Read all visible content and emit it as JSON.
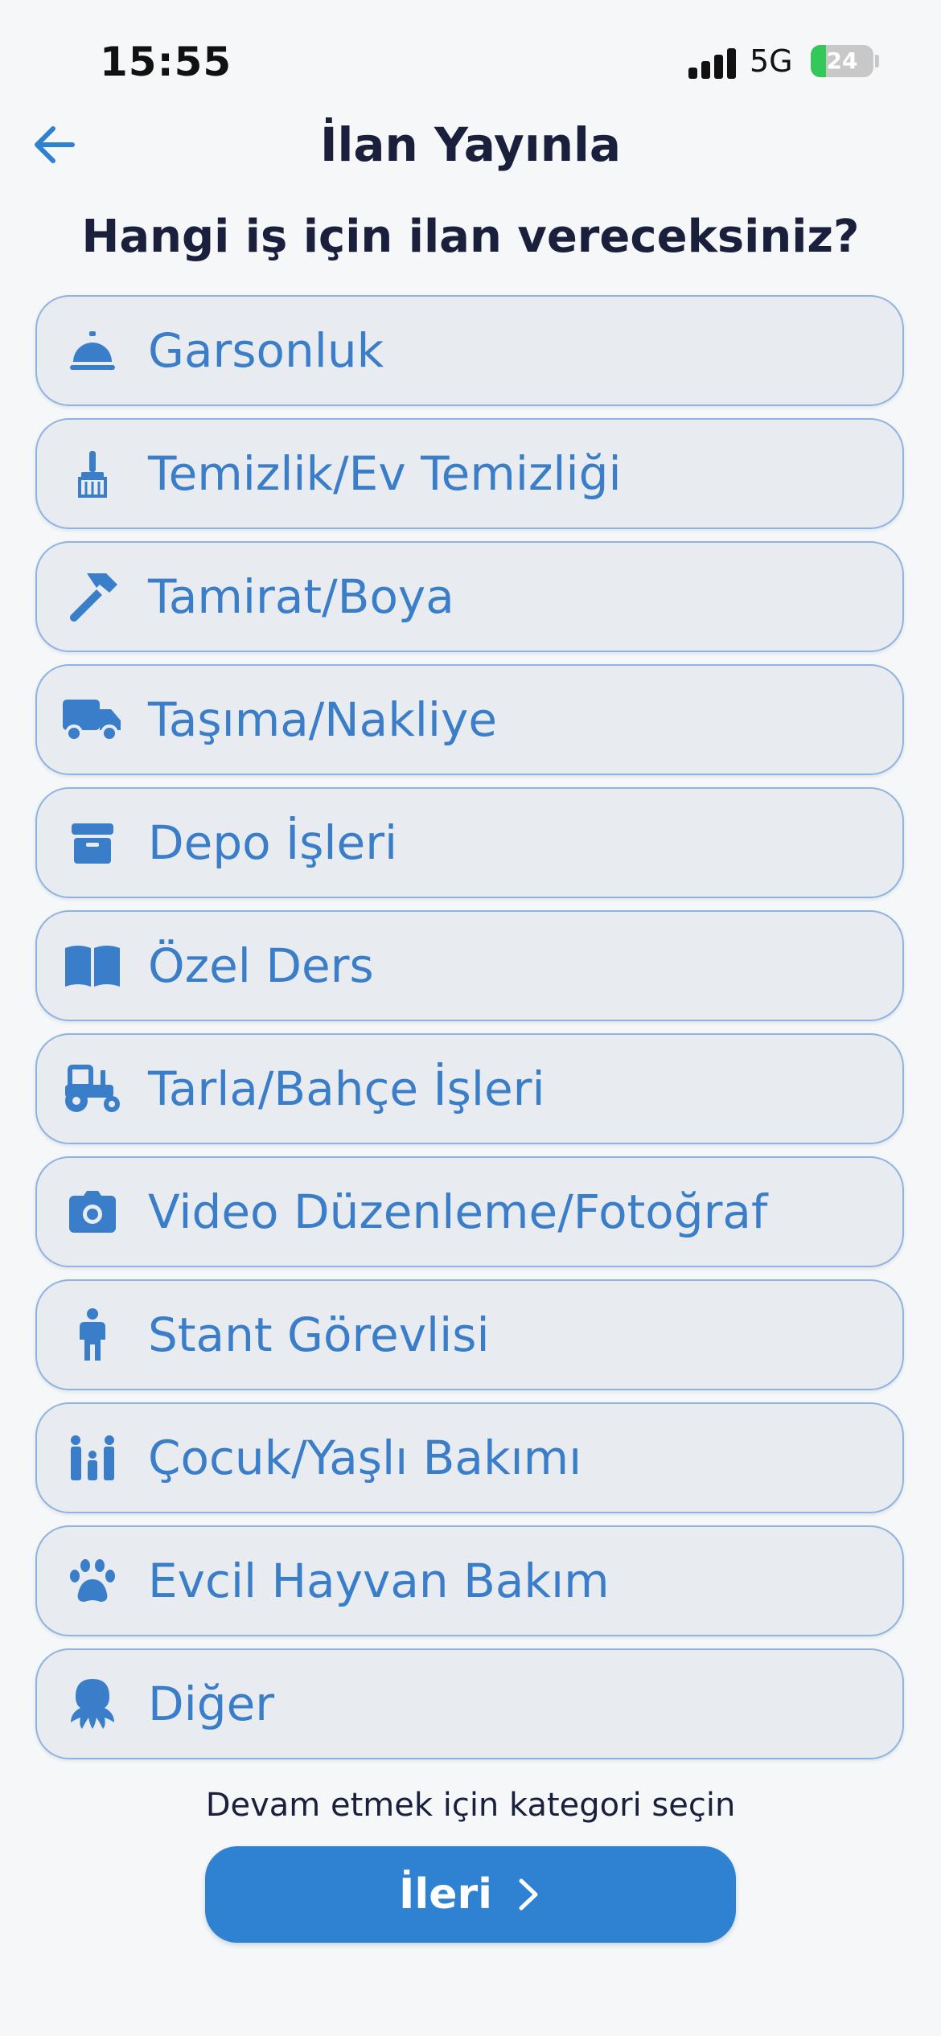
{
  "status_bar": {
    "time": "15:55",
    "network": "5G",
    "battery": "24",
    "battery_level": 0.24
  },
  "header": {
    "title": "İlan Yayınla",
    "back_icon": "arrow-left-icon"
  },
  "question": "Hangi iş için ilan vereceksiniz?",
  "categories": [
    {
      "label": "Garsonluk",
      "icon": "service-bell-icon"
    },
    {
      "label": "Temizlik/Ev Temizliği",
      "icon": "broom-icon"
    },
    {
      "label": "Tamirat/Boya",
      "icon": "hammer-icon"
    },
    {
      "label": "Taşıma/Nakliye",
      "icon": "truck-icon"
    },
    {
      "label": "Depo İşleri",
      "icon": "box-icon"
    },
    {
      "label": "Özel Ders",
      "icon": "book-icon"
    },
    {
      "label": "Tarla/Bahçe İşleri",
      "icon": "tractor-icon"
    },
    {
      "label": "Video Düzenleme/Fotoğraf",
      "icon": "camera-icon"
    },
    {
      "label": "Stant Görevlisi",
      "icon": "person-icon"
    },
    {
      "label": "Çocuk/Yaşlı Bakımı",
      "icon": "family-icon"
    },
    {
      "label": "Evcil Hayvan Bakım",
      "icon": "paw-icon"
    },
    {
      "label": "Diğer",
      "icon": "octopus-icon"
    }
  ],
  "hint": "Devam etmek için kategori seçin",
  "next_button": {
    "label": "İleri",
    "icon": "chevron-right-icon"
  },
  "colors": {
    "accent": "#2f82d1",
    "item_text": "#3a7dc9",
    "item_bg": "#e8ebef",
    "item_border": "#90b4e0",
    "title": "#1a1f3c"
  }
}
